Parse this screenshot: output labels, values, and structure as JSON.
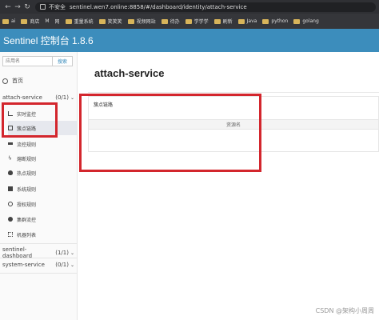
{
  "browser": {
    "insecure_label": "不安全",
    "url": "sentinel.wen7.online:8858/#/dashboard/identity/attach-service"
  },
  "bookmarks": [
    "ai",
    "商店",
    "M",
    "网",
    "重量系统",
    "笑笑笑",
    "视频网站",
    "待办",
    "学学学",
    "刷新",
    "Java",
    "python",
    "golang"
  ],
  "app": {
    "title": "Sentinel 控制台 1.8.6"
  },
  "sidebar": {
    "search_placeholder": "应用名",
    "search_button": "搜索",
    "home_label": "首页",
    "apps": [
      {
        "name": "attach-service",
        "count": "(0/1)"
      },
      {
        "name": "sentinel-dashboard",
        "count": "(1/1)"
      },
      {
        "name": "system-service",
        "count": "(0/1)"
      }
    ],
    "menu": [
      "实时监控",
      "簇点链路",
      "流控规则",
      "熔断规则",
      "热点规则",
      "系统规则",
      "授权规则",
      "集群流控",
      "机器列表"
    ]
  },
  "main": {
    "page_title": "attach-service",
    "panel_title": "簇点链路",
    "column_header": "资源名"
  },
  "watermark": "CSDN @架构小周周"
}
